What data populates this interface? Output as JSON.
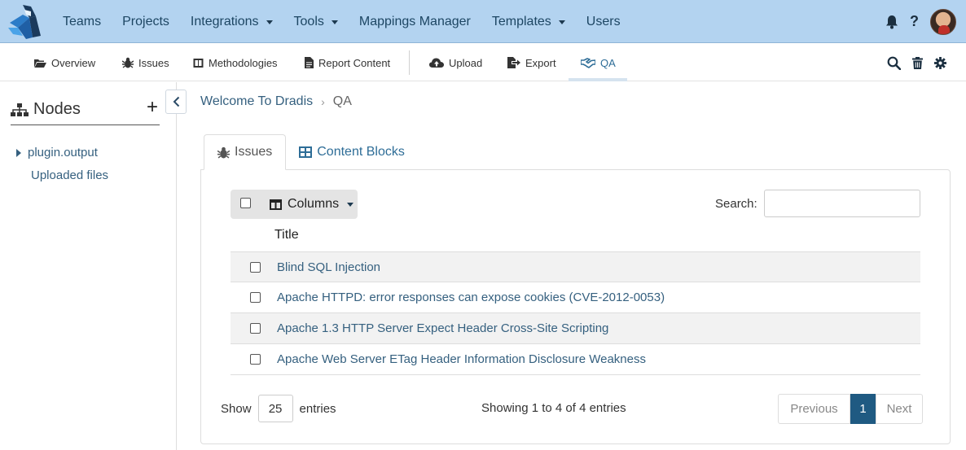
{
  "topnav": {
    "menu": [
      {
        "label": "Teams",
        "dropdown": false
      },
      {
        "label": "Projects",
        "dropdown": false
      },
      {
        "label": "Integrations",
        "dropdown": true
      },
      {
        "label": "Tools",
        "dropdown": true
      },
      {
        "label": "Mappings Manager",
        "dropdown": false
      },
      {
        "label": "Templates",
        "dropdown": true
      },
      {
        "label": "Users",
        "dropdown": false
      }
    ],
    "help_label": "?"
  },
  "subnav": {
    "items": [
      {
        "label": "Overview",
        "icon": "folder-open-icon"
      },
      {
        "label": "Issues",
        "icon": "bug-icon"
      },
      {
        "label": "Methodologies",
        "icon": "book-icon"
      },
      {
        "label": "Report Content",
        "icon": "file-icon"
      },
      {
        "label": "Upload",
        "icon": "cloud-upload-icon"
      },
      {
        "label": "Export",
        "icon": "export-icon"
      },
      {
        "label": "QA",
        "icon": "handshake-icon",
        "active": true
      }
    ]
  },
  "sidebar": {
    "title": "Nodes",
    "add_label": "+",
    "items": [
      {
        "label": "plugin.output",
        "expandable": true
      },
      {
        "label": "Uploaded files",
        "expandable": false
      }
    ]
  },
  "breadcrumb": {
    "parent": "Welcome To Dradis",
    "current": "QA"
  },
  "tabs": [
    {
      "label": "Issues",
      "icon": "bug-icon",
      "active": true
    },
    {
      "label": "Content Blocks",
      "icon": "table-icon",
      "active": false
    }
  ],
  "table": {
    "columns_button": "Columns",
    "search_label": "Search:",
    "search_value": "",
    "header_title": "Title",
    "rows": [
      "Blind SQL Injection",
      "Apache HTTPD: error responses can expose cookies (CVE-2012-0053)",
      "Apache 1.3 HTTP Server Expect Header Cross-Site Scripting",
      "Apache Web Server ETag Header Information Disclosure Weakness"
    ],
    "show_label": "Show",
    "page_size": "25",
    "entries_label": "entries",
    "info": "Showing 1 to 4 of 4 entries",
    "prev_label": "Previous",
    "page": "1",
    "next_label": "Next"
  },
  "colors": {
    "topbar": "#b3d3f0",
    "link": "#35607f",
    "active_page": "#1f5a82"
  }
}
